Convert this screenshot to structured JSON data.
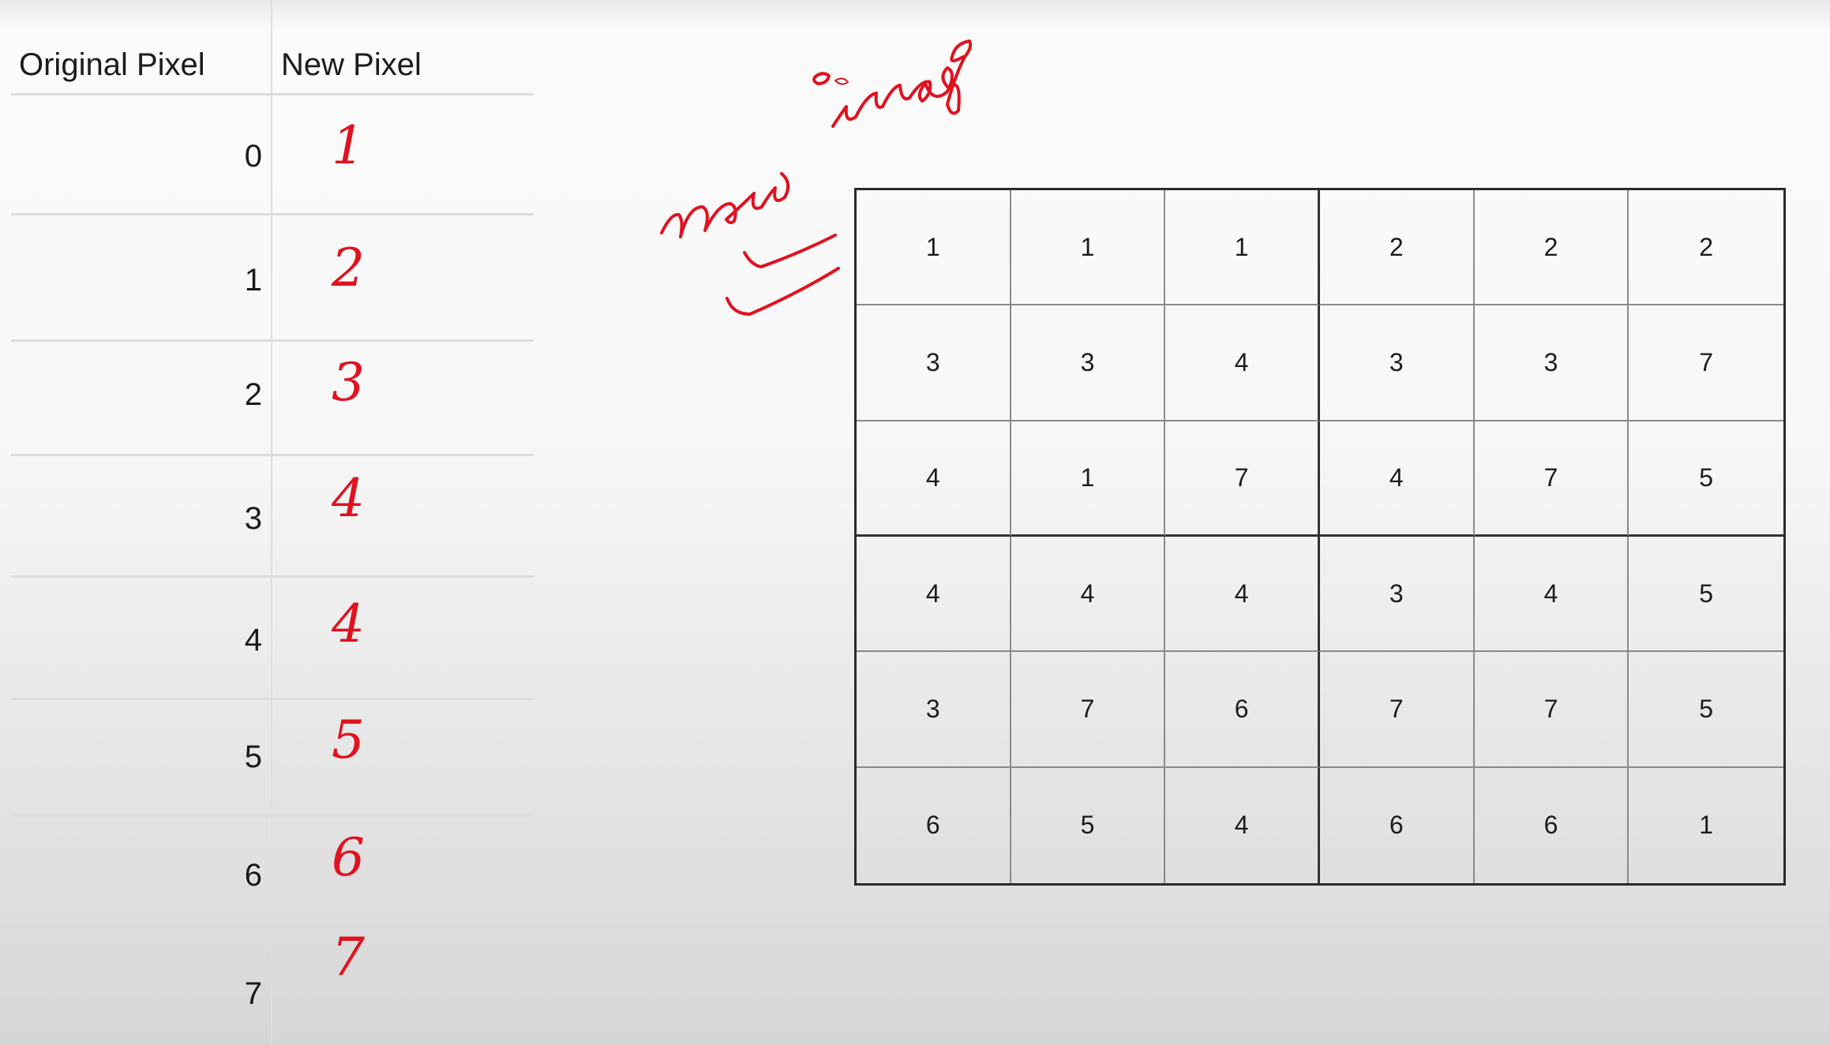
{
  "table": {
    "header_original": "Original Pixel",
    "header_new": "New Pixel",
    "rows": [
      {
        "original": "0",
        "new": "1"
      },
      {
        "original": "1",
        "new": "2"
      },
      {
        "original": "2",
        "new": "3"
      },
      {
        "original": "3",
        "new": "4"
      },
      {
        "original": "4",
        "new": "4"
      },
      {
        "original": "5",
        "new": "5"
      },
      {
        "original": "6",
        "new": "6"
      },
      {
        "original": "7",
        "new": "7"
      }
    ]
  },
  "annotation": {
    "text": "new image",
    "color": "#e0121f"
  },
  "image_grid": {
    "rows": [
      [
        "1",
        "1",
        "1",
        "2",
        "2",
        "2"
      ],
      [
        "3",
        "3",
        "4",
        "3",
        "3",
        "7"
      ],
      [
        "4",
        "1",
        "7",
        "4",
        "7",
        "5"
      ],
      [
        "4",
        "4",
        "4",
        "3",
        "4",
        "5"
      ],
      [
        "3",
        "7",
        "6",
        "7",
        "7",
        "5"
      ],
      [
        "6",
        "5",
        "4",
        "6",
        "6",
        "1"
      ]
    ]
  }
}
